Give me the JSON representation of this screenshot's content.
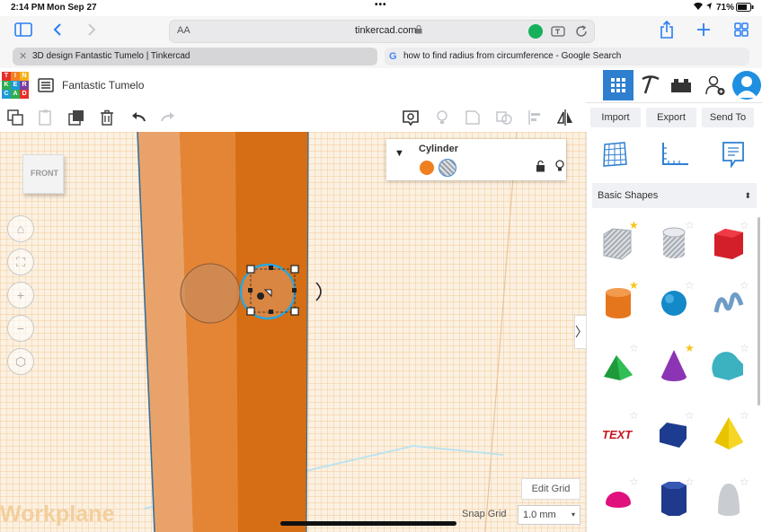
{
  "status_bar": {
    "time": "2:14 PM",
    "date": "Mon Sep 27",
    "battery": "71%"
  },
  "browser": {
    "text_size_label": "AA",
    "url": "tinkercad.com",
    "tabs": [
      {
        "label": "3D design Fantastic Tumelo | Tinkercad"
      },
      {
        "label": "how to find radius from circumference - Google Search"
      }
    ]
  },
  "app": {
    "logo_letters": [
      "T",
      "I",
      "N",
      "K",
      "E",
      "R",
      "C",
      "A",
      "D"
    ],
    "design_title": "Fantastic Tumelo",
    "toolbar": {
      "import_label": "Import",
      "export_label": "Export",
      "send_to_label": "Send To"
    }
  },
  "viewport": {
    "view_cube_label": "FRONT",
    "workplane_label": "Workplane",
    "edit_grid_label": "Edit Grid",
    "snap_grid_label": "Snap Grid",
    "snap_grid_value": "1.0 mm"
  },
  "inspector": {
    "shape_name": "Cylinder",
    "colors": {
      "solid": "#f07f1f",
      "hole": "#b7bcc4"
    }
  },
  "shapes_panel": {
    "category": "Basic Shapes",
    "shapes": [
      {
        "name": "box-hole",
        "starred": true
      },
      {
        "name": "cylinder-hole",
        "starred": false
      },
      {
        "name": "box",
        "starred": false
      },
      {
        "name": "cylinder",
        "starred": true
      },
      {
        "name": "sphere",
        "starred": false
      },
      {
        "name": "scribble",
        "starred": false
      },
      {
        "name": "roof",
        "starred": false
      },
      {
        "name": "cone",
        "starred": true
      },
      {
        "name": "round-roof",
        "starred": false
      },
      {
        "name": "text",
        "starred": false
      },
      {
        "name": "polygon",
        "starred": false
      },
      {
        "name": "pyramid",
        "starred": false
      },
      {
        "name": "half-sphere",
        "starred": false
      },
      {
        "name": "hexagonal-prism",
        "starred": false
      },
      {
        "name": "paraboloid",
        "starred": false
      }
    ]
  },
  "colors": {
    "accent": "#2f7fd1",
    "orange": "#e0761e",
    "brand_blue": "#1e8fe1"
  }
}
